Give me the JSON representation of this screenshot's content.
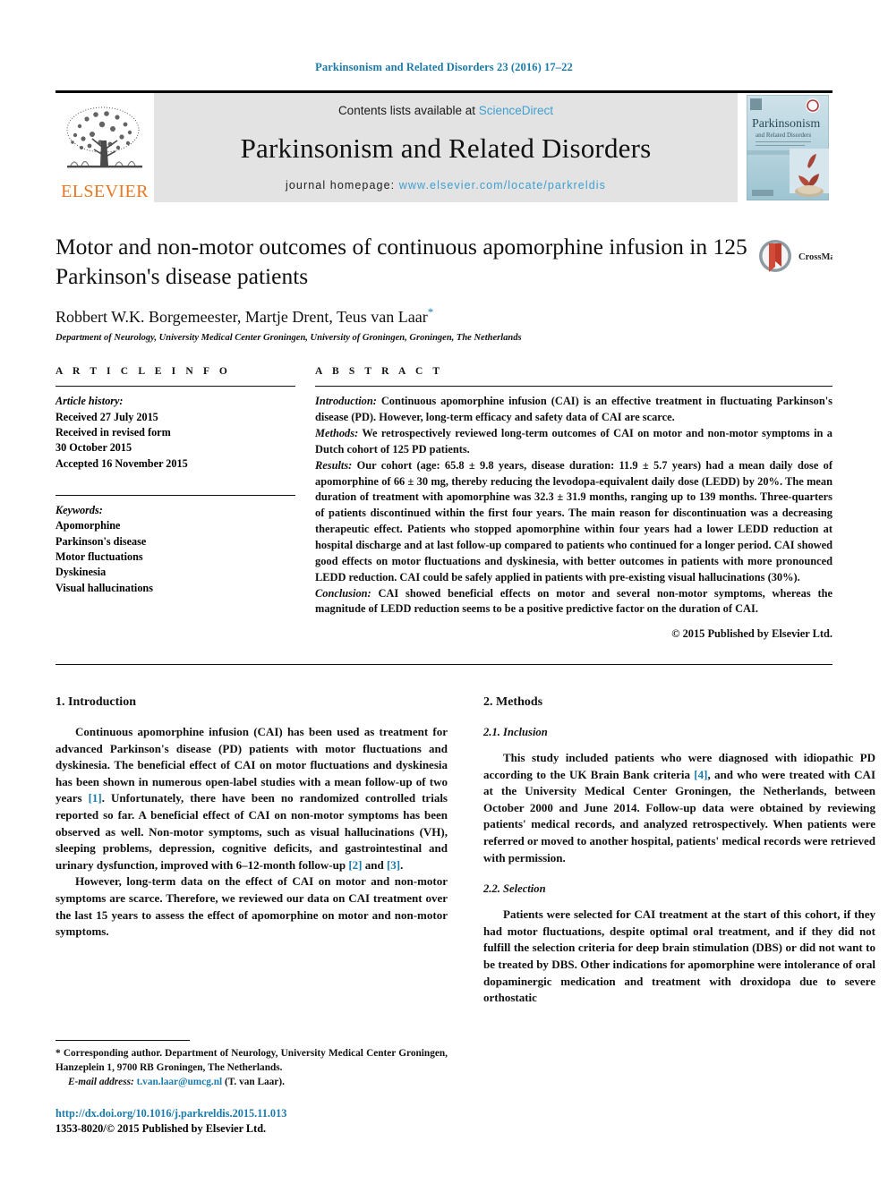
{
  "running_head": "Parkinsonism and Related Disorders 23 (2016) 17–22",
  "masthead": {
    "publisher_name": "ELSEVIER",
    "publisher_logo_icon": "elsevier-tree-icon",
    "contents_prefix": "Contents lists available at ",
    "contents_link": "ScienceDirect",
    "journal_name": "Parkinsonism and Related Disorders",
    "homepage_prefix": "journal homepage: ",
    "homepage_url": "www.elsevier.com/locate/parkreldis",
    "cover_alt": "journal-cover-thumbnail"
  },
  "title_block": {
    "title": "Motor and non-motor outcomes of continuous apomorphine infusion in 125 Parkinson's disease patients",
    "authors": "Robbert W.K. Borgemeester, Martje Drent, Teus van Laar",
    "corresponding_marker": "*",
    "affiliation": "Department of Neurology, University Medical Center Groningen, University of Groningen, Groningen, The Netherlands",
    "crossmark_label": "CrossMark"
  },
  "article_info": {
    "heading": "A R T I C L E   I N F O",
    "history_label": "Article history:",
    "history": [
      "Received 27 July 2015",
      "Received in revised form",
      "30 October 2015",
      "Accepted 16 November 2015"
    ],
    "keywords_label": "Keywords:",
    "keywords": [
      "Apomorphine",
      "Parkinson's disease",
      "Motor fluctuations",
      "Dyskinesia",
      "Visual hallucinations"
    ]
  },
  "abstract": {
    "heading": "A B S T R A C T",
    "introduction_label": "Introduction:",
    "introduction_text": " Continuous apomorphine infusion (CAI) is an effective treatment in fluctuating Parkinson's disease (PD). However, long-term efficacy and safety data of CAI are scarce.",
    "methods_label": "Methods:",
    "methods_text": " We retrospectively reviewed long-term outcomes of CAI on motor and non-motor symptoms in a Dutch cohort of 125 PD patients.",
    "results_label": "Results:",
    "results_text": " Our cohort (age: 65.8 ± 9.8 years, disease duration: 11.9 ± 5.7 years) had a mean daily dose of apomorphine of 66 ± 30 mg, thereby reducing the levodopa-equivalent daily dose (LEDD) by 20%. The mean duration of treatment with apomorphine was 32.3 ± 31.9 months, ranging up to 139 months. Three-quarters of patients discontinued within the first four years. The main reason for discontinuation was a decreasing therapeutic effect. Patients who stopped apomorphine within four years had a lower LEDD reduction at hospital discharge and at last follow-up compared to patients who continued for a longer period. CAI showed good effects on motor fluctuations and dyskinesia, with better outcomes in patients with more pronounced LEDD reduction. CAI could be safely applied in patients with pre-existing visual hallucinations (30%).",
    "conclusion_label": "Conclusion:",
    "conclusion_text": " CAI showed beneficial effects on motor and several non-motor symptoms, whereas the magnitude of LEDD reduction seems to be a positive predictive factor on the duration of CAI.",
    "copyright": "© 2015 Published by Elsevier Ltd."
  },
  "sections": {
    "introduction": {
      "heading": "1. Introduction",
      "paragraph_1_a": "Continuous apomorphine infusion (CAI) has been used as treatment for advanced Parkinson's disease (PD) patients with motor fluctuations and dyskinesia. The beneficial effect of CAI on motor fluctuations and dyskinesia has been shown in numerous open-label studies with a mean follow-up of two years ",
      "paragraph_1_ref1": "[1]",
      "paragraph_1_b": ". Unfortunately, there have been no randomized controlled trials reported so far. A beneficial effect of CAI on non-motor symptoms has been observed as well. Non-motor symptoms, such as visual hallucinations (VH), sleeping problems, depression, cognitive deficits, and gastrointestinal and urinary dysfunction, improved with 6–12-month follow-up ",
      "paragraph_1_ref2": "[2]",
      "paragraph_1_c": " and ",
      "paragraph_1_ref3": "[3]",
      "paragraph_1_d": ".",
      "paragraph_2": "However, long-term data on the effect of CAI on motor and non-motor symptoms are scarce. Therefore, we reviewed our data on CAI treatment over the last 15 years to assess the effect of apomorphine on motor and non-motor symptoms."
    },
    "methods": {
      "heading": "2. Methods",
      "inclusion_heading": "2.1. Inclusion",
      "inclusion_a": "This study included patients who were diagnosed with idiopathic PD according to the UK Brain Bank criteria ",
      "inclusion_ref": "[4]",
      "inclusion_b": ", and who were treated with CAI at the University Medical Center Groningen, the Netherlands, between October 2000 and June 2014. Follow-up data were obtained by reviewing patients' medical records, and analyzed retrospectively. When patients were referred or moved to another hospital, patients' medical records were retrieved with permission.",
      "selection_heading": "2.2. Selection",
      "selection_text": "Patients were selected for CAI treatment at the start of this cohort, if they had motor fluctuations, despite optimal oral treatment, and if they did not fulfill the selection criteria for deep brain stimulation (DBS) or did not want to be treated by DBS. Other indications for apomorphine were intolerance of oral dopaminergic medication and treatment with droxidopa due to severe orthostatic"
    }
  },
  "footnote": {
    "marker": "*",
    "text_a": " Corresponding author. Department of Neurology, University Medical Center Groningen, Hanzeplein 1, 9700 RB Groningen, The Netherlands.",
    "email_label": "E-mail address:",
    "email": "t.van.laar@umcg.nl",
    "email_suffix": " (T. van Laar).",
    "doi": "http://dx.doi.org/10.1016/j.parkreldis.2015.11.013",
    "issn_line": "1353-8020/© 2015 Published by Elsevier Ltd."
  },
  "colors": {
    "link_blue": "#1a7bab",
    "elsevier_orange": "#E87722",
    "masthead_grey": "#e3e3e3"
  }
}
